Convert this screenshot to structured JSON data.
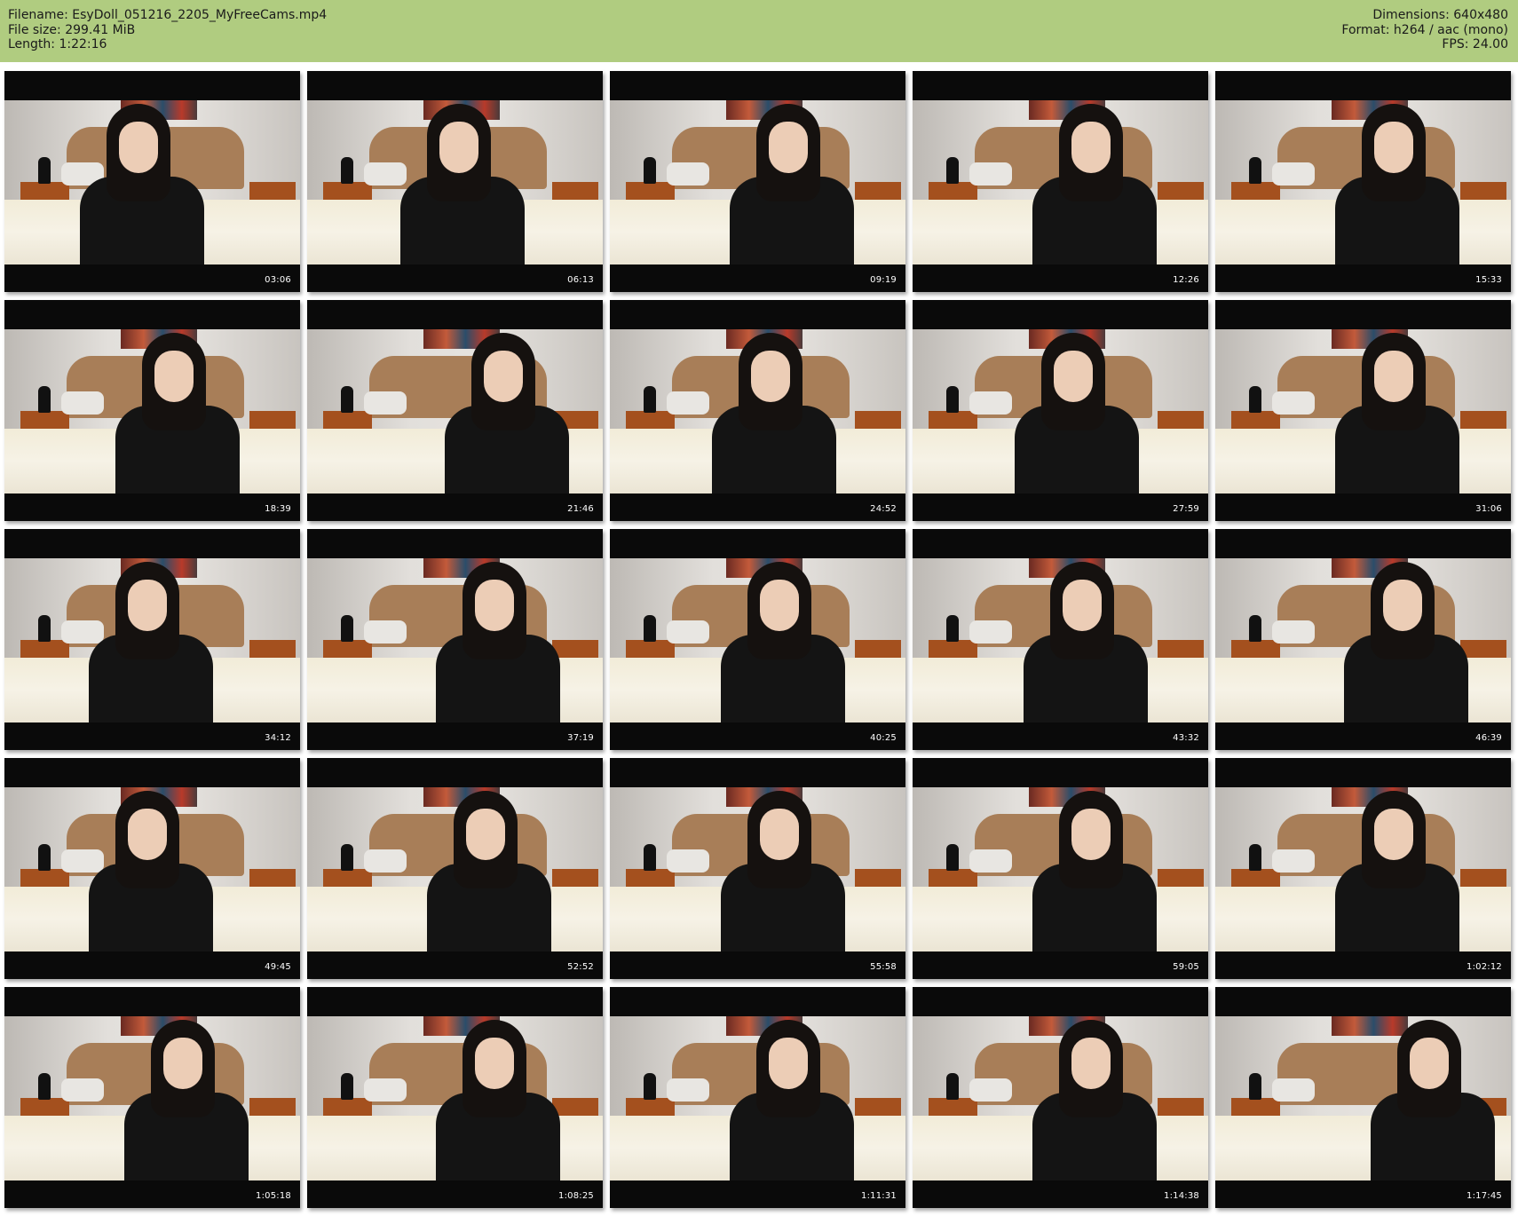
{
  "header": {
    "left": [
      "Filename: EsyDoll_051216_2205_MyFreeCams.mp4",
      "File size: 299.41 MiB",
      "Length: 1:22:16"
    ],
    "right": [
      "Dimensions: 640x480",
      "Format: h264 / aac (mono)",
      "FPS: 24.00"
    ]
  },
  "thumbnails": [
    "03:06",
    "06:13",
    "09:19",
    "12:26",
    "15:33",
    "18:39",
    "21:46",
    "24:52",
    "27:59",
    "31:06",
    "34:12",
    "37:19",
    "40:25",
    "43:32",
    "46:39",
    "49:45",
    "52:52",
    "55:58",
    "59:05",
    "1:02:12",
    "1:05:18",
    "1:08:25",
    "1:11:31",
    "1:14:38",
    "1:17:45"
  ]
}
